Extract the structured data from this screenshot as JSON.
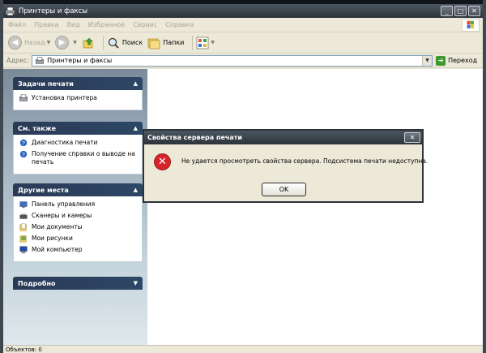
{
  "window": {
    "title": "Принтеры и факсы",
    "buttons": [
      "_",
      "□",
      "✕"
    ]
  },
  "menu": [
    "Файл",
    "Правка",
    "Вид",
    "Избранное",
    "Сервис",
    "Справка"
  ],
  "toolbar": {
    "back_label": "Назад",
    "search_label": "Поиск",
    "folders_label": "Папки"
  },
  "address": {
    "label": "Адрес:",
    "value": "Принтеры и факсы",
    "go_label": "Переход"
  },
  "panels": {
    "print_tasks": {
      "title": "Задачи печати",
      "items": [
        "Установка принтера"
      ]
    },
    "see_also": {
      "title": "См. также",
      "items": [
        "Диагностика печати",
        "Получение справки о выводе на печать"
      ]
    },
    "other_places": {
      "title": "Другие места",
      "items": [
        "Панель управления",
        "Сканеры и камеры",
        "Мои документы",
        "Мои рисунки",
        "Мой компьютер"
      ]
    },
    "details": {
      "title": "Подробно"
    }
  },
  "status": {
    "objects": "Объектов: 0"
  },
  "dialog": {
    "title": "Свойства сервера печати",
    "message": "Не удается просмотреть свойства сервера. Подсистема печати недоступна.",
    "ok_label": "OK",
    "close_glyph": "✕",
    "error_glyph": "✕"
  },
  "colors": {
    "titlebar": "#3a434b",
    "panel_header": "#2d4766",
    "error_red": "#d5252b"
  }
}
